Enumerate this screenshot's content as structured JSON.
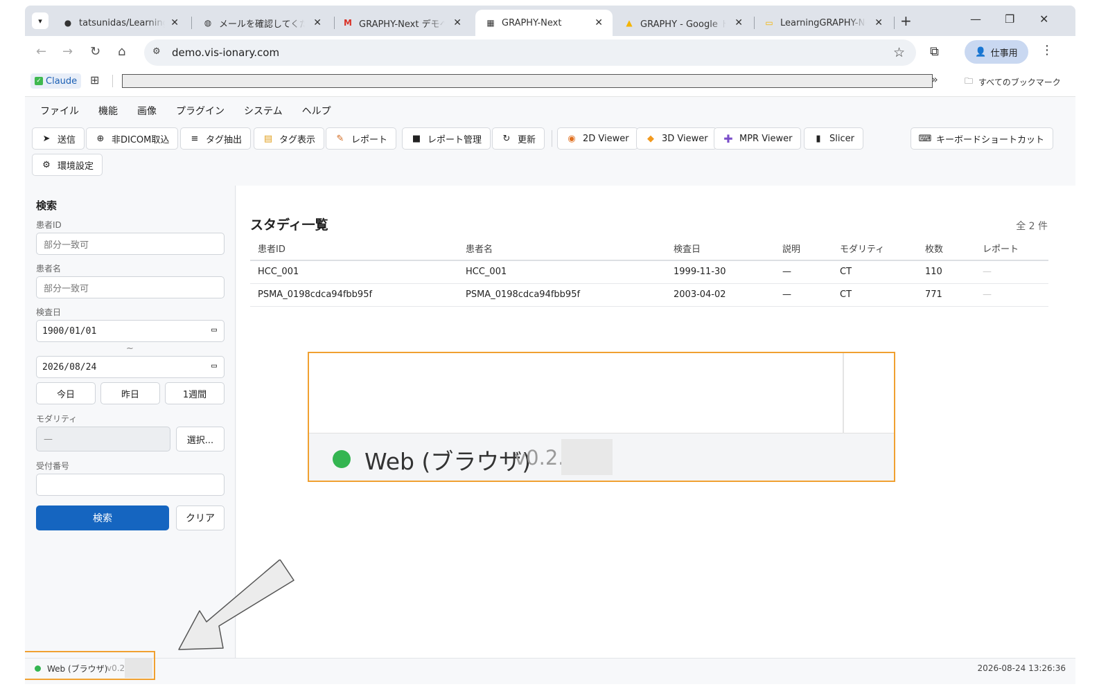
{
  "browser": {
    "tabs": [
      {
        "label": "tatsunidas/LearningGRAPHY",
        "icon": "github-icon"
      },
      {
        "label": "メールを確認してください",
        "icon": "globe-icon"
      },
      {
        "label": "GRAPHY-Next デモへの",
        "icon": "gmail-icon"
      },
      {
        "label": "GRAPHY-Next",
        "icon": "graphy-icon"
      },
      {
        "label": "GRAPHY - Google ドライブ",
        "icon": "drive-icon"
      },
      {
        "label": "LearningGRAPHY-Next",
        "icon": "slides-icon"
      }
    ],
    "active_tab_index": 3,
    "url": "demo.vis-ionary.com",
    "profile_label": "仕事用",
    "bookmarks": {
      "claude_label": "Claude",
      "all_bookmarks_label": "すべてのブックマーク"
    }
  },
  "app": {
    "menu": [
      "ファイル",
      "機能",
      "画像",
      "プラグイン",
      "システム",
      "ヘルプ"
    ],
    "actions": {
      "send": "送信",
      "non_dicom_import": "非DICOM取込",
      "tag_extract": "タグ抽出",
      "tag_display": "タグ表示",
      "report": "レポート",
      "report_manage": "レポート管理",
      "refresh": "更新",
      "viewer_2d": "2D Viewer",
      "viewer_3d": "3D Viewer",
      "viewer_mpr": "MPR Viewer",
      "slicer": "Slicer",
      "keyboard_shortcuts": "キーボードショートカット",
      "settings": "環境設定"
    },
    "search": {
      "title": "検索",
      "patient_id_label": "患者ID",
      "patient_id_placeholder": "部分一致可",
      "patient_name_label": "患者名",
      "patient_name_placeholder": "部分一致可",
      "exam_date_label": "検査日",
      "date_from": "1900/01/01",
      "date_to": "2026/08/24",
      "range_separator": "~",
      "quick_today": "今日",
      "quick_yesterday": "昨日",
      "quick_week": "1週間",
      "modality_label": "モダリティ",
      "modality_value": "—",
      "select_button": "選択...",
      "accession_label": "受付番号",
      "accession_value": "",
      "search_button": "検索",
      "clear_button": "クリア"
    },
    "study_list": {
      "title": "スタディ一覧",
      "count": "全 2 件",
      "columns": [
        "患者ID",
        "患者名",
        "検査日",
        "説明",
        "モダリティ",
        "枚数",
        "レポート"
      ],
      "rows": [
        [
          "HCC_001",
          "HCC_001",
          "1999-11-30",
          "—",
          "CT",
          "110",
          "—"
        ],
        [
          "PSMA_0198cdca94fbb95f",
          "PSMA_0198cdca94fbb95f",
          "2003-04-02",
          "—",
          "CT",
          "771",
          "—"
        ]
      ]
    },
    "status": {
      "platform": "Web (ブラウザ)",
      "version_prefix": "v0.2.",
      "timestamp": "2026-08-24 13:26:36"
    },
    "callout": {
      "platform": "Web (ブラウザ)",
      "version_prefix": "v0.2."
    },
    "colors": {
      "primary_button": "#1565c0",
      "status_ok": "#34b551",
      "highlight_border": "#f0a030"
    }
  }
}
